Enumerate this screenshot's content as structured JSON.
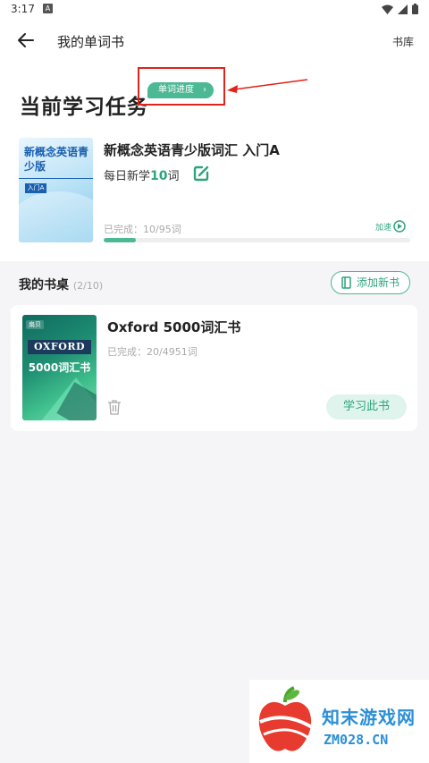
{
  "status_bar": {
    "time": "3:17",
    "notification": "A"
  },
  "nav": {
    "title": "我的单词书",
    "library": "书库"
  },
  "current_task": {
    "heading": "当前学习任务",
    "badge": "单词进度",
    "book_title": "新概念英语青少版词汇 入门A",
    "cover_title": "新概念英语青少版",
    "cover_tag": "入门A",
    "daily_prefix": "每日新学",
    "daily_count": "10",
    "daily_suffix": "词",
    "completed": "已完成：10/95词",
    "accelerate": "加速",
    "progress": 0.105
  },
  "desk": {
    "heading": "我的书桌",
    "count": "(2/10)",
    "add_button": "添加新书"
  },
  "books": [
    {
      "title": "Oxford 5000词汇书",
      "cover_tag": "扇贝",
      "cover_brand": "OXFORD",
      "cover_sub": "5000词汇书",
      "completed": "已完成：20/4951词",
      "study_button": "学习此书"
    }
  ],
  "watermark": {
    "text": "知末游戏网",
    "url": "ZM028.CN"
  },
  "colors": {
    "accent": "#4cb894",
    "accent_text": "#2fa37c",
    "highlight": "#e2231a"
  }
}
